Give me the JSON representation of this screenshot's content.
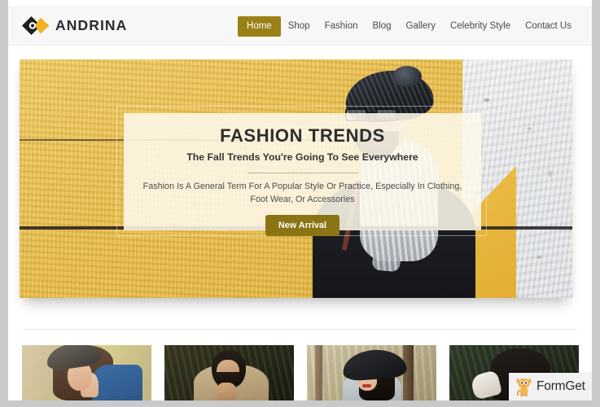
{
  "site": {
    "brand_name": "ANDRINA",
    "logo_icon": "diamond-chevron-logo-icon",
    "accent_color": "#9a8016",
    "button_color": "#8b7414",
    "wall_yellow": "#e8b93f",
    "wall_white": "#e2e4e7"
  },
  "nav": {
    "items": [
      {
        "label": "Home",
        "active": true
      },
      {
        "label": "Shop",
        "active": false
      },
      {
        "label": "Fashion",
        "active": false
      },
      {
        "label": "Blog",
        "active": false
      },
      {
        "label": "Gallery",
        "active": false
      },
      {
        "label": "Celebrity Style",
        "active": false
      },
      {
        "label": "Contact Us",
        "active": false
      }
    ]
  },
  "hero": {
    "title": "FASHION TRENDS",
    "subtitle": "The Fall Trends You're Going To See Everywhere",
    "description": "Fashion Is A General Term For A Popular Style Or Practice, Especially In Clothing, Foot Wear, Or Accessories",
    "cta_label": "New Arrival",
    "image_alt": "Man in black beanie, glasses and white knit scarf against yellow and white textured wall"
  },
  "gallery": {
    "items": [
      {
        "alt": "Woman in grey hat and blue denim shirt"
      },
      {
        "alt": "Bearded man in beige blazer against dark green background"
      },
      {
        "alt": "Woman in black wide-brim hat in a forest"
      },
      {
        "alt": "Figure in dark clothing with white gloves"
      }
    ]
  },
  "watermark": {
    "label": "FormGet",
    "icon": "cat-mascot-icon"
  }
}
